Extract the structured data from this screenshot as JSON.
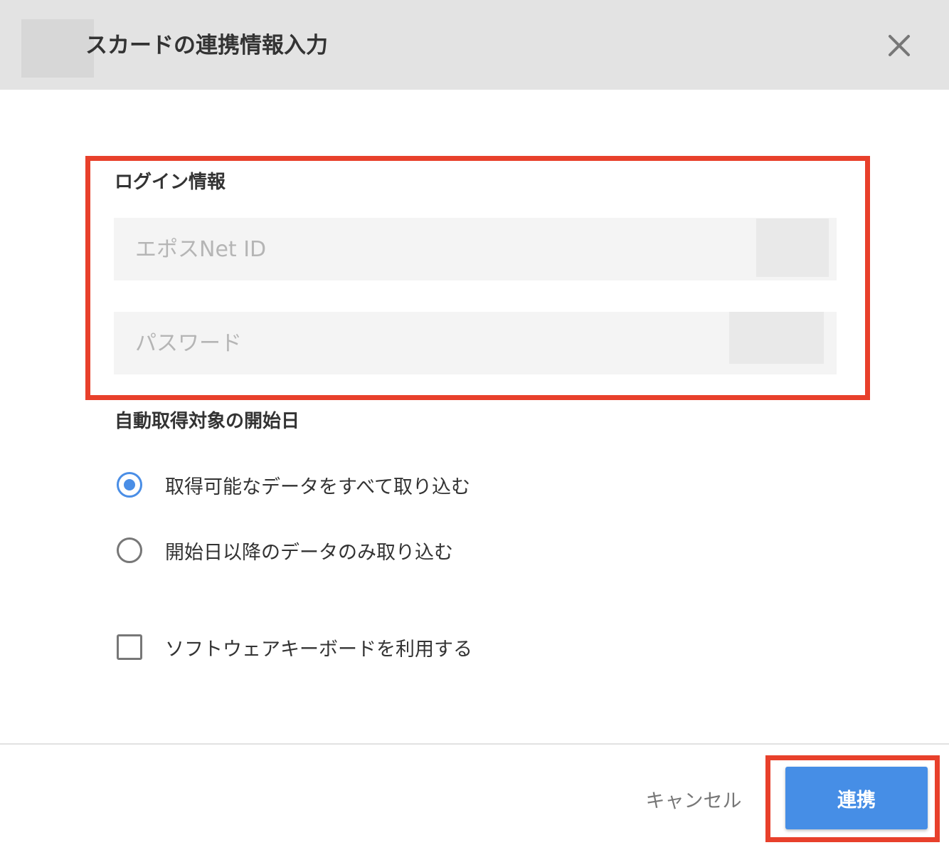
{
  "header": {
    "title": "スカードの連携情報入力",
    "close_icon": "close-icon"
  },
  "login": {
    "label": "ログイン情報",
    "id_placeholder": "エポスNet ID",
    "password_placeholder": "パスワード"
  },
  "start_date": {
    "label": "自動取得対象の開始日",
    "options": [
      {
        "label": "取得可能なデータをすべて取り込む",
        "checked": true
      },
      {
        "label": "開始日以降のデータのみ取り込む",
        "checked": false
      }
    ]
  },
  "software_keyboard": {
    "label": "ソフトウェアキーボードを利用する",
    "checked": false
  },
  "footer": {
    "cancel_label": "キャンセル",
    "submit_label": "連携"
  },
  "colors": {
    "accent": "#468ee6",
    "highlight": "#e8402b",
    "header_bg": "#e3e3e3"
  }
}
